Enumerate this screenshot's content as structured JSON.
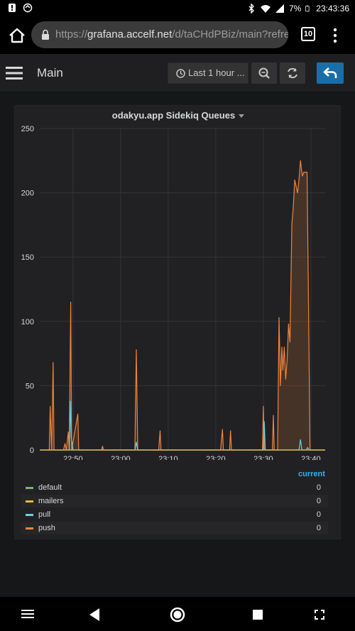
{
  "status_bar": {
    "battery": "7%",
    "time": "23:43:36",
    "icons": [
      "alert-icon",
      "sync-icon",
      "bluetooth-icon",
      "wifi-icon",
      "signal-icon",
      "battery-icon"
    ]
  },
  "browser": {
    "url_scheme": "https://",
    "url_host": "grafana.accelf.net",
    "url_path": "/d/taCHdPBiz/main?refres",
    "tab_count": "10"
  },
  "app_bar": {
    "title": "Main",
    "time_range": "Last 1 hour ..."
  },
  "panel": {
    "title": "odakyu.app Sidekiq Queues"
  },
  "legend": {
    "header": "current",
    "items": [
      {
        "name": "default",
        "value": "0",
        "color": "#7eb26d"
      },
      {
        "name": "mailers",
        "value": "0",
        "color": "#eab839"
      },
      {
        "name": "pull",
        "value": "0",
        "color": "#6ed0e0"
      },
      {
        "name": "push",
        "value": "0",
        "color": "#ef843c"
      }
    ]
  },
  "chart_data": {
    "type": "line",
    "x_ticks": [
      "22:50",
      "23:00",
      "23:10",
      "23:20",
      "23:30",
      "23:40"
    ],
    "y_ticks": [
      "0",
      "50",
      "100",
      "150",
      "200",
      "250"
    ],
    "xlim": [
      "22:43",
      "23:43"
    ],
    "ylim": [
      0,
      250
    ],
    "grid": true,
    "legend_placement": "bottom",
    "series": [
      {
        "name": "push",
        "color": "#ef843c",
        "fill": true,
        "points": [
          [
            0,
            0
          ],
          [
            2,
            0
          ],
          [
            2.2,
            34
          ],
          [
            2.5,
            0
          ],
          [
            2.8,
            68
          ],
          [
            3.0,
            0
          ],
          [
            5,
            0
          ],
          [
            5.3,
            5
          ],
          [
            5.6,
            0
          ],
          [
            6,
            14
          ],
          [
            6.2,
            0
          ],
          [
            6.5,
            115
          ],
          [
            6.7,
            0
          ],
          [
            8,
            28
          ],
          [
            8.2,
            0
          ],
          [
            13,
            0
          ],
          [
            13.2,
            3
          ],
          [
            13.4,
            0
          ],
          [
            20,
            0
          ],
          [
            20.3,
            78
          ],
          [
            20.6,
            0
          ],
          [
            25,
            0
          ],
          [
            25.3,
            15
          ],
          [
            25.5,
            0
          ],
          [
            38,
            0
          ],
          [
            38.4,
            16
          ],
          [
            38.6,
            0
          ],
          [
            39.9,
            0
          ],
          [
            40.1,
            15
          ],
          [
            40.3,
            0
          ],
          [
            46.8,
            0
          ],
          [
            47.0,
            34
          ],
          [
            47.2,
            0
          ],
          [
            48.9,
            0
          ],
          [
            49.1,
            27
          ],
          [
            49.3,
            0
          ],
          [
            50,
            0
          ],
          [
            50.3,
            103
          ],
          [
            50.6,
            50
          ],
          [
            50.9,
            80
          ],
          [
            51.1,
            62
          ],
          [
            51.4,
            80
          ],
          [
            51.7,
            55
          ],
          [
            52,
            70
          ],
          [
            52.3,
            98
          ],
          [
            52.6,
            84
          ],
          [
            53,
            176
          ],
          [
            53.3,
            189
          ],
          [
            53.6,
            210
          ],
          [
            53.9,
            205
          ],
          [
            54.2,
            200
          ],
          [
            54.5,
            210
          ],
          [
            54.8,
            225
          ],
          [
            55.2,
            213
          ],
          [
            55.5,
            216
          ],
          [
            56.2,
            216
          ],
          [
            56.5,
            110
          ],
          [
            56.8,
            0
          ],
          [
            60,
            0
          ]
        ]
      },
      {
        "name": "pull",
        "color": "#6ed0e0",
        "fill": false,
        "points": [
          [
            0,
            0
          ],
          [
            6.2,
            0
          ],
          [
            6.4,
            38
          ],
          [
            6.6,
            10
          ],
          [
            7.0,
            0
          ],
          [
            20,
            0
          ],
          [
            20.3,
            6
          ],
          [
            20.6,
            0
          ],
          [
            47,
            0
          ],
          [
            47.2,
            22
          ],
          [
            47.4,
            0
          ],
          [
            54.5,
            0
          ],
          [
            54.8,
            8
          ],
          [
            55.1,
            0
          ],
          [
            56,
            0
          ],
          [
            56.3,
            2
          ],
          [
            56.6,
            0
          ],
          [
            60,
            0
          ]
        ]
      },
      {
        "name": "default",
        "color": "#7eb26d",
        "fill": false,
        "points": [
          [
            0,
            0
          ],
          [
            60,
            0
          ]
        ]
      },
      {
        "name": "mailers",
        "color": "#eab839",
        "fill": false,
        "points": [
          [
            0,
            0
          ],
          [
            60,
            0
          ]
        ]
      }
    ]
  }
}
